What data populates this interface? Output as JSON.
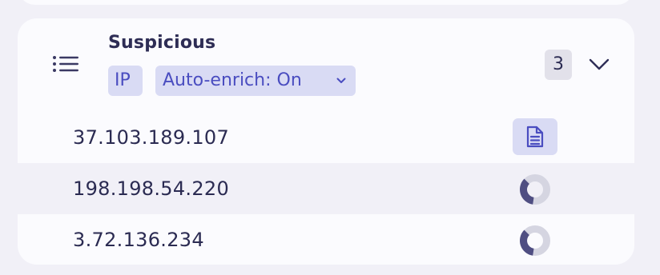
{
  "group": {
    "title": "Suspicious",
    "type_chip": "IP",
    "enrich_chip": "Auto-enrich: On",
    "count": "3",
    "icons": {
      "group": "list-icon",
      "enrich_dropdown": "chevron-down-icon",
      "collapse": "chevron-down-icon"
    }
  },
  "rows": [
    {
      "ip": "37.103.189.107",
      "status": "report",
      "icon": "document-icon"
    },
    {
      "ip": "198.198.54.220",
      "status": "loading",
      "icon": "progress-ring-icon",
      "progress": 0.35
    },
    {
      "ip": "3.72.136.234",
      "status": "loading",
      "icon": "progress-ring-icon",
      "progress": 0.35
    }
  ],
  "colors": {
    "accent": "#4a4dc0",
    "chip_bg": "#d9dbf4",
    "text": "#2b2b52",
    "ring_fill": "#4f4e82",
    "ring_track": "#d5d5e1"
  }
}
